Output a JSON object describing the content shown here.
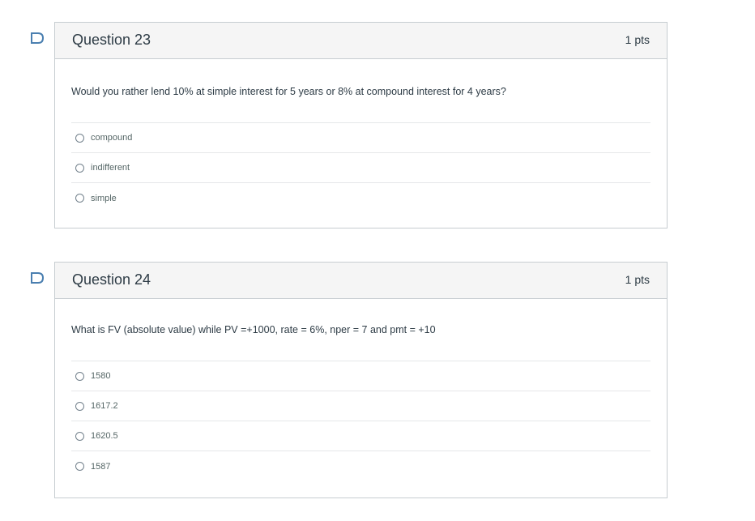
{
  "questions": [
    {
      "title": "Question 23",
      "points": "1 pts",
      "text": "Would you rather lend 10% at simple interest for 5 years or 8% at compound interest for 4 years?",
      "answers": [
        "compound",
        "indifferent",
        "simple"
      ]
    },
    {
      "title": "Question 24",
      "points": "1 pts",
      "text": "What is FV (absolute value) while PV =+1000, rate = 6%, nper = 7 and pmt = +10",
      "answers": [
        "1580",
        "1617.2",
        "1620.5",
        "1587"
      ]
    }
  ],
  "colors": {
    "flag": "#4a7fb0",
    "border": "#c7cdd1",
    "header_bg": "#f5f5f5"
  },
  "icons": {
    "flag": "flag-icon",
    "radio": "radio-icon"
  }
}
